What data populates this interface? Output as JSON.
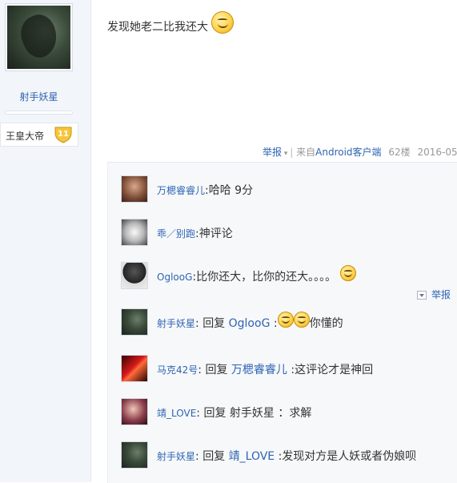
{
  "author": {
    "name": "射手妖星",
    "title": "王皇大帝",
    "level": "11",
    "avatar_icon": "dragon-avatar"
  },
  "post": {
    "text": "发现她老二比我还大",
    "emoji": "smile-emoji"
  },
  "meta": {
    "report": "举报",
    "source_prefix": "来自",
    "source": "Android客户端",
    "floor": "62楼",
    "date": "2016-05-"
  },
  "replies": [
    {
      "user": "万楒睿睿儿",
      "sep": ":",
      "text": "哈哈 9分"
    },
    {
      "user": "乖／别跑",
      "sep": ":",
      "text": "神评论"
    },
    {
      "user": "OglooG",
      "sep": ":",
      "text": "比你还大，比你的还大。。。。"
    },
    {
      "user": "射手妖星",
      "sep": ":",
      "reply_word": "回复",
      "target": "OglooG",
      "target_sep": ":",
      "text": "你懂的"
    },
    {
      "user": "马克42号",
      "sep": ":",
      "reply_word": "回复",
      "target": "万楒睿睿儿",
      "target_sep": ":",
      "text": "这评论才是神回"
    },
    {
      "user": "靖_LOVE",
      "sep": ":",
      "reply_word": "回复",
      "target": "射手妖星",
      "target_sep": "：",
      "text": "求解"
    },
    {
      "user": "射手妖星",
      "sep": ":",
      "reply_word": "回复",
      "target": "靖_LOVE",
      "target_sep": ":",
      "text": "发现对方是人妖或者伪娘呗"
    }
  ],
  "reply_action": {
    "label": "举报"
  },
  "colors": {
    "link": "#2d64b3",
    "meta": "#999999",
    "reply_bg": "#f7f8fa"
  }
}
